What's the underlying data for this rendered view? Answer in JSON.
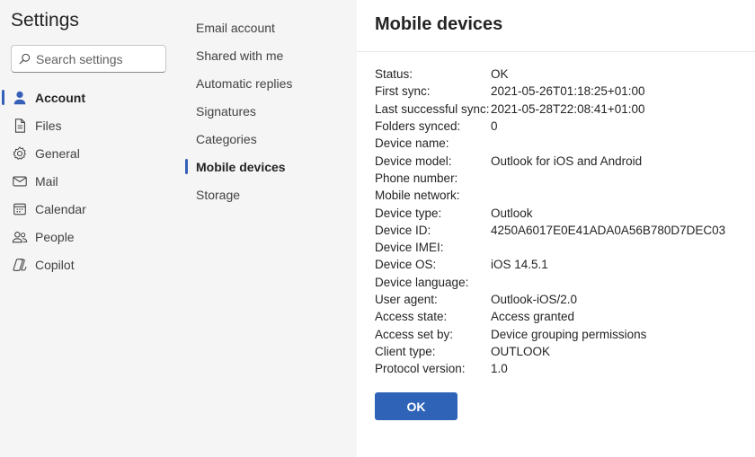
{
  "nav": {
    "title": "Settings",
    "search_placeholder": "Search settings",
    "items": [
      {
        "label": "Account",
        "icon": "person-icon",
        "active": true
      },
      {
        "label": "Files",
        "icon": "file-icon"
      },
      {
        "label": "General",
        "icon": "gear-icon"
      },
      {
        "label": "Mail",
        "icon": "mail-icon"
      },
      {
        "label": "Calendar",
        "icon": "calendar-icon"
      },
      {
        "label": "People",
        "icon": "people-icon"
      },
      {
        "label": "Copilot",
        "icon": "copilot-icon"
      }
    ]
  },
  "subnav": {
    "items": [
      {
        "label": "Email account"
      },
      {
        "label": "Shared with me"
      },
      {
        "label": "Automatic replies"
      },
      {
        "label": "Signatures"
      },
      {
        "label": "Categories"
      },
      {
        "label": "Mobile devices",
        "active": true
      },
      {
        "label": "Storage"
      }
    ]
  },
  "main": {
    "title": "Mobile devices",
    "details": [
      {
        "key": "Status:",
        "value": "OK"
      },
      {
        "key": "First sync:",
        "value": "2021-05-26T01:18:25+01:00"
      },
      {
        "key": "Last successful sync:",
        "value": "2021-05-28T22:08:41+01:00"
      },
      {
        "key": "Folders synced:",
        "value": "0"
      },
      {
        "key": "Device name:",
        "value": ""
      },
      {
        "key": "Device model:",
        "value": "Outlook for iOS and Android"
      },
      {
        "key": "Phone number:",
        "value": ""
      },
      {
        "key": "Mobile network:",
        "value": ""
      },
      {
        "key": "Device type:",
        "value": "Outlook"
      },
      {
        "key": "Device ID:",
        "value": "4250A6017E0E41ADA0A56B780D7DEC03"
      },
      {
        "key": "Device IMEI:",
        "value": ""
      },
      {
        "key": "Device OS:",
        "value": "iOS 14.5.1"
      },
      {
        "key": "Device language:",
        "value": ""
      },
      {
        "key": "User agent:",
        "value": "Outlook-iOS/2.0"
      },
      {
        "key": "Access state:",
        "value": "Access granted"
      },
      {
        "key": "Access set by:",
        "value": "Device grouping permissions"
      },
      {
        "key": "Client type:",
        "value": "OUTLOOK"
      },
      {
        "key": "Protocol version:",
        "value": "1.0"
      }
    ],
    "ok_label": "OK"
  },
  "colors": {
    "accent": "#3660b7",
    "button": "#2e63b8",
    "nav_bg": "#f5f5f5"
  }
}
